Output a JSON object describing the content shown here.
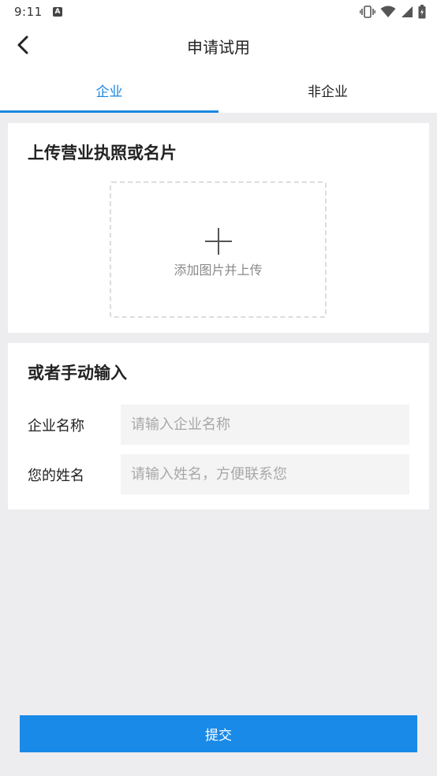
{
  "status_bar": {
    "time": "9:11",
    "notification_icon": "a-icon",
    "icons": [
      "vibrate-icon",
      "wifi-icon",
      "signal-icon",
      "battery-icon"
    ]
  },
  "header": {
    "title": "申请试用",
    "back_icon": "chevron-left-icon"
  },
  "tabs": [
    {
      "label": "企业",
      "active": true
    },
    {
      "label": "非企业",
      "active": false
    }
  ],
  "upload_section": {
    "title": "上传营业执照或名片",
    "hint": "添加图片并上传",
    "icon": "plus-icon"
  },
  "manual_section": {
    "title": "或者手动输入",
    "fields": [
      {
        "label": "企业名称",
        "value": "",
        "placeholder": "请输入企业名称"
      },
      {
        "label": "您的姓名",
        "value": "",
        "placeholder": "请输入姓名，方便联系您"
      }
    ]
  },
  "submit_label": "提交",
  "colors": {
    "accent": "#1a86e0",
    "button": "#1a8ae8",
    "background": "#ededf0"
  }
}
